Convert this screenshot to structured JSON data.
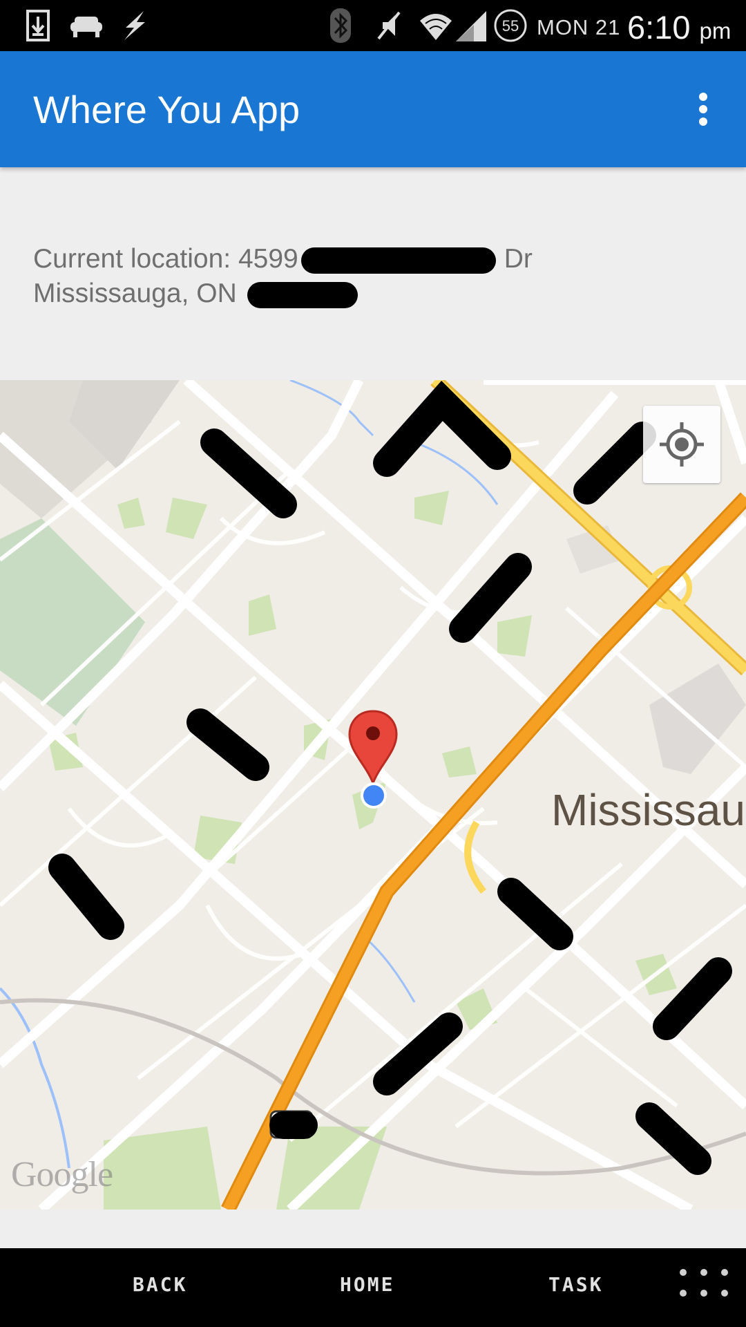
{
  "status_bar": {
    "date": "MON 21",
    "time": "6:10",
    "ampm": "pm",
    "battery_level": "55",
    "icons": [
      "download-icon",
      "sofa-icon",
      "flash-icon",
      "bluetooth-icon",
      "mute-icon",
      "wifi-icon",
      "signal-icon",
      "battery-icon"
    ]
  },
  "app_bar": {
    "title": "Where You App",
    "overflow_icon": "overflow-menu-icon",
    "color": "#1976d2"
  },
  "location": {
    "line1_prefix": "Current location: 4599",
    "line1_suffix": "Dr",
    "line2_prefix": "Mississauga, ON"
  },
  "map": {
    "city_label": "Mississau",
    "logo_text": "Google",
    "my_location_icon": "my-location-icon",
    "marker_icon": "map-pin-icon",
    "current_position_icon": "current-position-dot",
    "highway_color": "#f59e1e",
    "major_road_color": "#fbd15a"
  },
  "nav_bar": {
    "back_label": "BACK",
    "home_label": "HOME",
    "task_label": "TASK",
    "menu_icon": "apps-grid-icon"
  }
}
